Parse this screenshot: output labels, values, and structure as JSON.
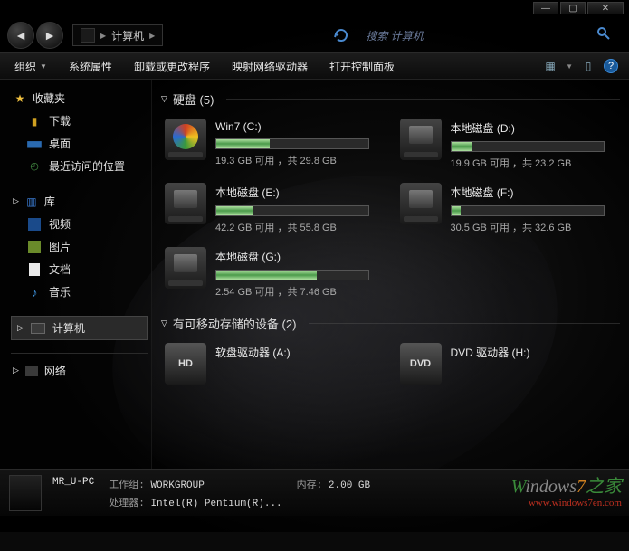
{
  "titlebar": {
    "min": "—",
    "max": "▢",
    "close": "✕"
  },
  "nav": {
    "back": "◄",
    "forward": "►",
    "breadcrumb_icon": "■",
    "breadcrumb_label": "计算机",
    "refresh_icon": "↻",
    "search_placeholder": "搜索 计算机",
    "search_icon": "🔍"
  },
  "toolbar": {
    "items": [
      "组织",
      "系统属性",
      "卸载或更改程序",
      "映射网络驱动器",
      "打开控制面板"
    ],
    "view_icon": "▦",
    "help": "?"
  },
  "sidebar": {
    "favorites": {
      "label": "收藏夹",
      "items": [
        "下载",
        "桌面",
        "最近访问的位置"
      ]
    },
    "libraries": {
      "label": "库",
      "items": [
        "视频",
        "图片",
        "文档",
        "音乐"
      ]
    },
    "computer": {
      "label": "计算机"
    },
    "network": {
      "label": "网络"
    }
  },
  "content": {
    "drives_header": "硬盘 (5)",
    "drives": [
      {
        "name": "Win7 (C:)",
        "free": "19.3 GB 可用 ，共 29.8 GB",
        "pct": 35,
        "icon": "win"
      },
      {
        "name": "本地磁盘 (D:)",
        "free": "19.9 GB 可用 ，共 23.2 GB",
        "pct": 14,
        "icon": "hd"
      },
      {
        "name": "本地磁盘 (E:)",
        "free": "42.2 GB 可用 ，共 55.8 GB",
        "pct": 24,
        "icon": "hd"
      },
      {
        "name": "本地磁盘 (F:)",
        "free": "30.5 GB 可用 ，共 32.6 GB",
        "pct": 6,
        "icon": "hd"
      },
      {
        "name": "本地磁盘 (G:)",
        "free": "2.54 GB 可用 ，共 7.46 GB",
        "pct": 66,
        "icon": "hd"
      }
    ],
    "devices_header": "有可移动存储的设备 (2)",
    "devices": [
      {
        "name": "软盘驱动器 (A:)",
        "badge": "HD"
      },
      {
        "name": "DVD 驱动器 (H:)",
        "badge": "DVD"
      }
    ]
  },
  "status": {
    "pc_name": "MR_U-PC",
    "workgroup_label": "工作组:",
    "workgroup": "WORKGROUP",
    "mem_label": "内存:",
    "mem": "2.00 GB",
    "cpu_label": "处理器:",
    "cpu": "Intel(R) Pentium(R)..."
  },
  "watermark": {
    "line1a": "W",
    "line1b": "indows",
    "line1c": "7",
    "line1d": "之家",
    "url": "www.windows7en.com"
  }
}
